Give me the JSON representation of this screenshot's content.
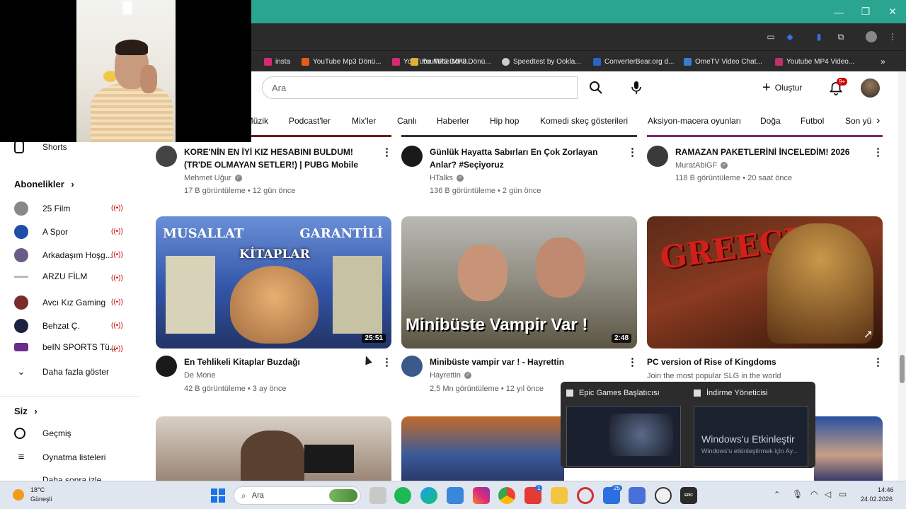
{
  "window": {
    "minimize": "—",
    "restore": "❐",
    "close": "✕"
  },
  "bookmarks": [
    {
      "label": "insta",
      "color": "#d62976"
    },
    {
      "label": "YouTube Mp3 Dönü...",
      "color": "#e85a1c"
    },
    {
      "label": "YouTube MP3 Dönü...",
      "color": "#d62976"
    },
    {
      "label": "Speedtest by Ookla...",
      "color": "#cccccc"
    },
    {
      "label": "ConverterBear.org d...",
      "color": "#2b63c6"
    },
    {
      "label": "OmeTV Video Chat...",
      "color": "#3b7bd1"
    },
    {
      "label": "Youtube MP4 Video...",
      "color": "#c0306b"
    }
  ],
  "header": {
    "search_placeholder": "Ara",
    "create_label": "Oluştur",
    "notif_count": "9+"
  },
  "chips": [
    "Müzik",
    "Podcast'ler",
    "Mix'ler",
    "Canlı",
    "Haberler",
    "Hip hop",
    "Komedi skeç gösterileri",
    "Aksiyon-macera oyunları",
    "Doğa",
    "Futbol",
    "Son yü"
  ],
  "sidebar": {
    "shorts": "Shorts",
    "subs_title": "Abonelikler",
    "subs": [
      {
        "name": "25 Film",
        "color": "#888888"
      },
      {
        "name": "A Spor",
        "color": "#1e4ea8"
      },
      {
        "name": "Arkadaşım Hoşg...",
        "color": "#6a5c88"
      },
      {
        "name": "ARZU FİLM",
        "color": "#bbbbbb"
      },
      {
        "name": "Avcı Kız Gaming",
        "color": "#7a2c2c"
      },
      {
        "name": "Behzat Ç.",
        "color": "#1c2340"
      },
      {
        "name": "beIN SPORTS Tü...",
        "color": "#6b2c8c"
      }
    ],
    "more": "Daha fazla göster",
    "you_title": "Siz",
    "history": "Geçmiş",
    "playlists": "Oynatma listeleri",
    "partial": "Daha sonra izle"
  },
  "videos_row1": [
    {
      "title": "KORE'NİN EN İYİ KIZ HESABINI BULDUM! (TR'DE OLMAYAN SETLER!) | PUBG Mobile",
      "channel": "Mehmet Uğur",
      "meta": "17 B görüntüleme • 12 gün önce",
      "avatar": "#444444"
    },
    {
      "title": "Günlük Hayatta Sabırları En Çok Zorlayan Anlar? #Seçiyoruz",
      "channel": "HTalks",
      "meta": "136 B görüntüleme • 2 gün önce",
      "avatar": "#1a1a1a"
    },
    {
      "title": "RAMAZAN PAKETLERİNİ İNCELEDİM! 2026",
      "channel": "MuratAbiGF",
      "meta": "118 B görüntüleme • 20 saat önce",
      "avatar": "#3a3a3a"
    }
  ],
  "videos_row2": [
    {
      "title": "En Tehlikeli Kitaplar Buzdağı",
      "channel": "De Mone",
      "meta": "42 B görüntüleme • 3 ay önce",
      "duration": "25:51",
      "avatar": "#1a1a1a",
      "thumb_top": "MUSALLAT",
      "thumb_right": "GARANTİLİ",
      "thumb_mid": "KİTAPLAR"
    },
    {
      "title": "Minibüste vampir var ! - Hayrettin",
      "channel": "Hayrettin",
      "meta": "2,5 Mn görüntüleme • 12 yıl önce",
      "duration": "2:48",
      "avatar": "#3b5a8a",
      "thumb_text": "Minibüste Vampir Var !"
    },
    {
      "title": "PC version of Rise of Kingdoms",
      "channel": "Join the most popular SLG in the world",
      "thumb_text": "GREECE"
    }
  ],
  "popup": {
    "app1": "Epic Games Başlatıcısı",
    "app2": "İndirme Yöneticisi",
    "watermark1": "Windows'u Etkinleştir",
    "watermark2": "Windows'u etkinleştirmek için Ay..."
  },
  "taskbar": {
    "temp": "18°C",
    "weather": "Güneşli",
    "search": "Ara",
    "time": "14:46",
    "date": "24.02.2026",
    "badge_a": "1",
    "badge_b": "25",
    "epic": "EPIC GAMES"
  }
}
